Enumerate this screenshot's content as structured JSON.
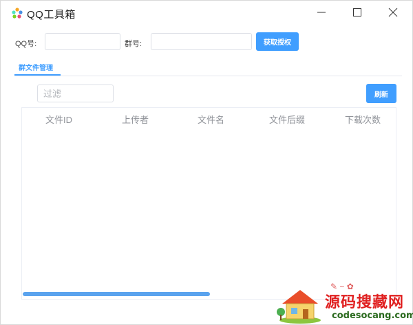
{
  "window": {
    "title": "QQ工具箱",
    "controls": [
      "minimize-icon",
      "maximize-icon",
      "close-icon"
    ]
  },
  "form": {
    "qq_label": "QQ号:",
    "qq_value": "",
    "group_label": "群号:",
    "group_value": "",
    "auth_button": "获取授权"
  },
  "tabs": [
    {
      "label": "群文件管理",
      "active": true
    }
  ],
  "toolbar": {
    "filter_placeholder": "过滤",
    "filter_value": "",
    "refresh_button": "刷新"
  },
  "table": {
    "columns": [
      "文件ID",
      "上传者",
      "文件名",
      "文件后缀",
      "下载次数"
    ],
    "rows": [],
    "scroll_position": 0.5
  },
  "watermark": {
    "title": "源码搜藏网",
    "url": "codesocang.com"
  },
  "colors": {
    "accent": "#409eff",
    "header_text": "#909399",
    "watermark_red": "#e02020",
    "watermark_green": "#2a6a1e"
  }
}
